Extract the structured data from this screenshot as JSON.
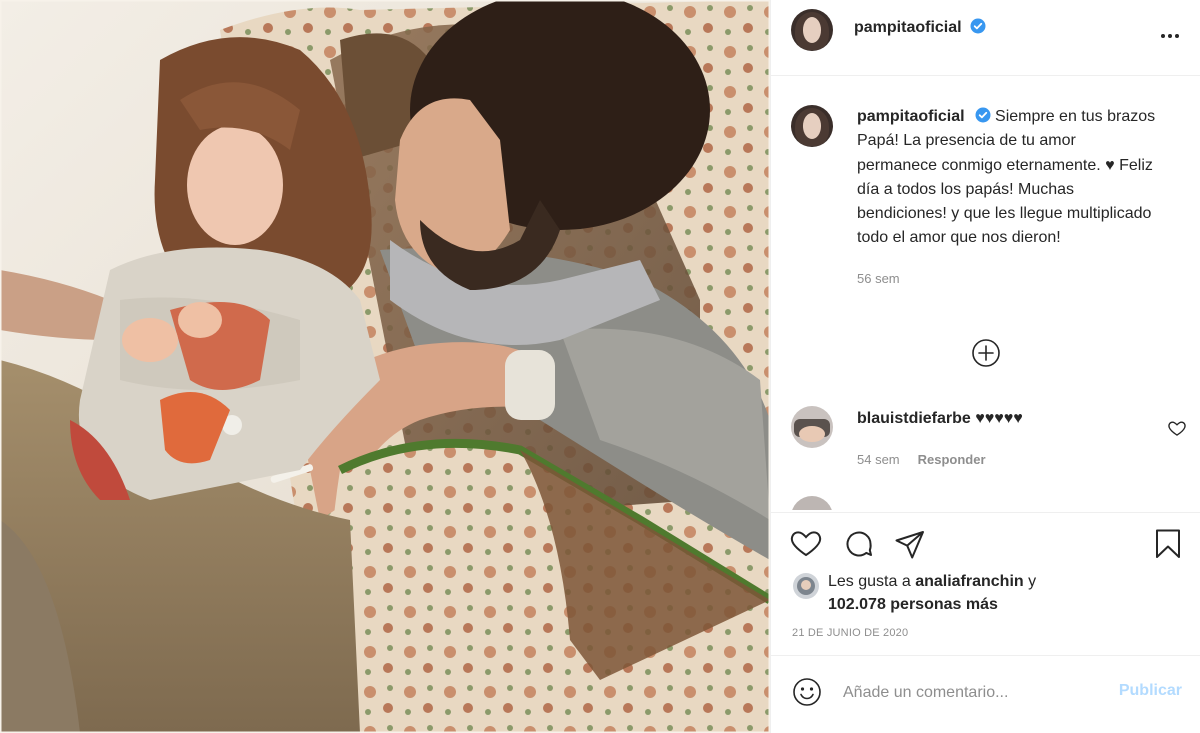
{
  "post": {
    "username": "pampitaoficial",
    "caption": "Siempre en tus brazos Papá! La presencia de tu amor permanece conmigo eternamente. ♥ Feliz día a todos los papás! Muchas bendiciones! y que les llegue multiplicado todo el amor que nos dieron!",
    "caption_time": "56 sem",
    "date": "21 de junio de 2020"
  },
  "comments": [
    {
      "username": "blauistdiefarbe",
      "text": "♥♥♥♥♥",
      "time": "54 sem",
      "reply_label": "Responder"
    }
  ],
  "likes": {
    "prefix": "Les gusta a",
    "liked_by": "analiafranchin",
    "conjunction": "y",
    "others": "102.078 personas más"
  },
  "comment_box": {
    "placeholder": "Añade un comentario...",
    "post_label": "Publicar"
  },
  "icons": {
    "more": "more-options-icon",
    "verified": "verified-badge-icon",
    "load_more": "load-more-comments-icon",
    "like": "heart-icon",
    "comment": "comment-icon",
    "share": "share-icon",
    "save": "save-bookmark-icon",
    "emoji": "emoji-icon"
  },
  "colors": {
    "verified": "#3897f0",
    "text": "#262626",
    "secondary": "#8e8e8e",
    "post_disabled": "#b3dbff"
  }
}
